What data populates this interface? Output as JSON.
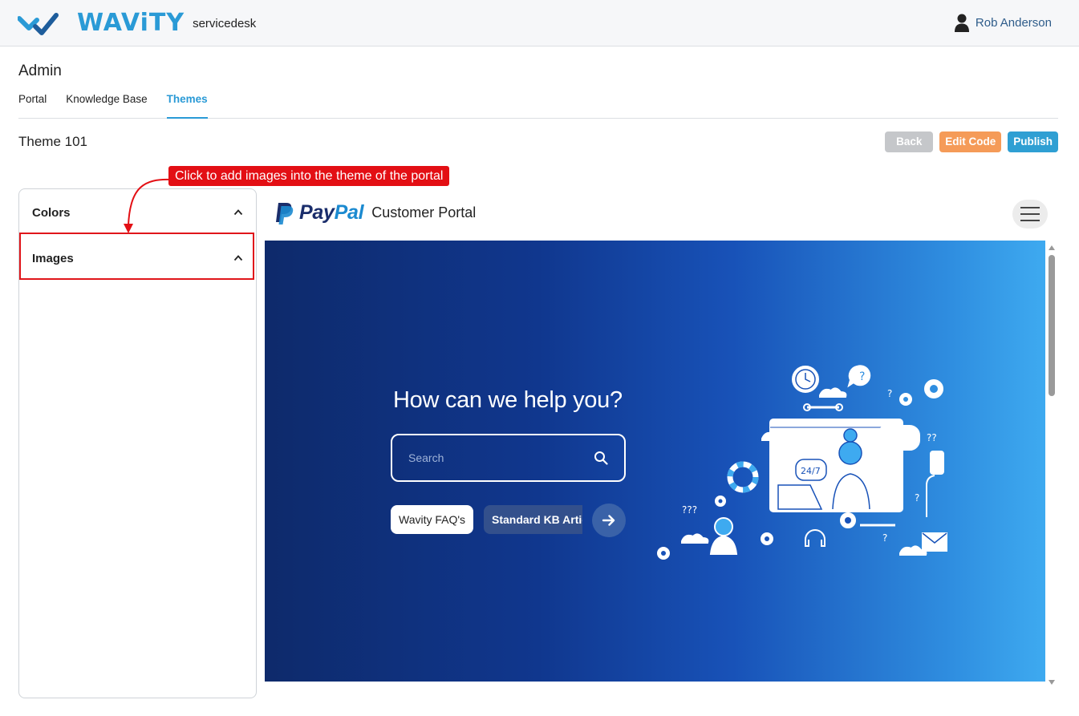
{
  "header": {
    "logo_text": "WAViTY",
    "product": "servicedesk",
    "user_name": "Rob Anderson"
  },
  "page": {
    "title": "Admin",
    "tabs": [
      {
        "label": "Portal",
        "active": false
      },
      {
        "label": "Knowledge Base",
        "active": false
      },
      {
        "label": "Themes",
        "active": true
      }
    ],
    "theme_name": "Theme 101"
  },
  "actions": {
    "back": "Back",
    "edit_code": "Edit Code",
    "publish": "Publish"
  },
  "sidebar": {
    "sections": [
      {
        "label": "Colors"
      },
      {
        "label": "Images"
      }
    ]
  },
  "annotation": {
    "callout_text": "Click to add images into the theme of the portal"
  },
  "preview": {
    "brand_pay": "Pay",
    "brand_pal": "Pal",
    "portal_title": "Customer Portal",
    "hero_title": "How can we help you?",
    "search_placeholder": "Search",
    "chips": [
      "Wavity FAQ's",
      "Standard KB Articles"
    ]
  },
  "colors": {
    "accent": "#2a9ad6",
    "back_button": "#c5c7ca",
    "edit_button": "#f59b58",
    "publish_button": "#2f9fd3",
    "callout": "#e30f14",
    "hero_gradient_start": "#0e2a6b",
    "hero_gradient_end": "#3eaaf0"
  },
  "icons": [
    "wavity-logo-icon",
    "user-icon",
    "chevron-up-icon",
    "paypal-logo-icon",
    "hamburger-menu-icon",
    "search-icon",
    "arrow-right-icon",
    "support-illustration"
  ]
}
